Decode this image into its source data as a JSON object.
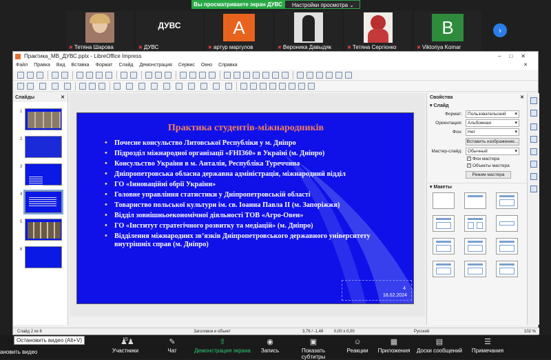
{
  "zoom": {
    "share_banner": "Вы просматриваете экран ДУВС",
    "view_settings": "Настройки просмотра",
    "participants": [
      {
        "name": "Тетяна Шарова",
        "type": "photo",
        "color": "#b07a6a"
      },
      {
        "name": "ДУВС",
        "type": "text",
        "label": "ДУВС"
      },
      {
        "name": "артур маргулов",
        "type": "letter",
        "letter": "А",
        "color": "#e8641e"
      },
      {
        "name": "Вероника Давыдяк",
        "type": "photo",
        "color": "#d8d8d8"
      },
      {
        "name": "Тетяна Сергієнко",
        "type": "photo",
        "color": "#c03030"
      },
      {
        "name": "Viktoriya Komar",
        "type": "letter",
        "letter": "В",
        "color": "#2e8b3c"
      }
    ],
    "toolbar": {
      "tooltip": "Остановить видео (Alt+V)",
      "stop_video": "ановить видео",
      "participants_label": "Участники",
      "participants_count": "15",
      "chat": "Чат",
      "share_screen": "Демонстрация экрана",
      "record": "Запись",
      "subtitles": "Показать субтитры",
      "reactions": "Реакции",
      "apps": "Приложения",
      "whiteboards": "Доски сообщений",
      "notes": "Примечания"
    }
  },
  "impress": {
    "window_title": "Практика_МВ_ДУВС.pptx - LibreOffice Impress",
    "menu": [
      "Файл",
      "Правка",
      "Вид",
      "Вставка",
      "Формат",
      "Слайд",
      "Демонстрация",
      "Сервис",
      "Окно",
      "Справка"
    ],
    "slides_pane_title": "Слайды",
    "slide_count_thumbs": [
      1,
      2,
      3,
      4,
      5,
      6
    ],
    "selected_slide": 4,
    "slide": {
      "title": "Практика студентів-міжнародників",
      "bullets": [
        "Почесне консульство Литовської Республіки у м. Дніпро",
        "Підрозділ міжнародної організації «FHI360» в Україні (м. Дніпро)",
        "Консульство України в м. Анталія, Республіка Туреччина",
        "Дніпропетровська обласна державна адміністрація, міжнародний відділ",
        "ГО «Інноваційні обрії України»",
        "Головне управління статистики у Дніпропетровській області",
        "Товариство польської культури ім. св. Іоанна Павла ІІ (м. Запоріжжя)",
        "Відділ зовнішньоекономічної діяльності ТОВ «Агро-Овен»",
        "ГО «Інститут стратегічного розвитку та медіацій» (м. Дніпро)",
        "Відділення міжнародних зв’язків Дніпропетровського державного університету внутрішніх справ (м. Дніпро)"
      ],
      "page_number": "4",
      "date": "18.02.2024"
    },
    "properties": {
      "title": "Свойства",
      "section_slide": "Слайд",
      "format_label": "Формат:",
      "format_value": "Пользовательский",
      "orientation_label": "Ориентация:",
      "orientation_value": "Альбомная",
      "background_label": "Фон:",
      "background_value": "Нет",
      "insert_image": "Вставить изображение...",
      "master_label": "Мастер-слайд:",
      "master_value": "Обычный",
      "master_bg": "Фон мастера",
      "master_objects": "Объекты мастера",
      "master_mode": "Режим мастера",
      "section_layouts": "Макеты"
    },
    "status": {
      "slide_of": "Слайд 2 из 6",
      "layout": "Заголовок и объект",
      "position": "3,76 / -1,48",
      "size": "0,00 x 0,00",
      "language": "Русский",
      "zoom": "102 %"
    }
  }
}
